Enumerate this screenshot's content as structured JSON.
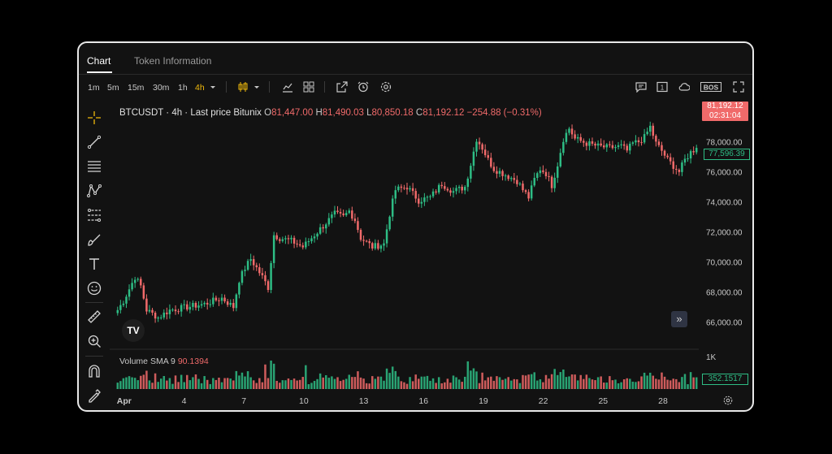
{
  "tabs": [
    {
      "label": "Chart",
      "active": true
    },
    {
      "label": "Token Information",
      "active": false
    }
  ],
  "toolbar": {
    "intervals": [
      "1m",
      "5m",
      "15m",
      "30m",
      "1h",
      "4h"
    ],
    "active_interval": "4h",
    "right_badge": "BOS",
    "one_label": "1"
  },
  "legend": {
    "symbol": "BTCUSDT · 4h · Last price Bitunix",
    "o_label": "O",
    "o": "81,447.00",
    "h_label": "H",
    "h": "81,490.03",
    "l_label": "L",
    "l": "80,850.18",
    "c_label": "C",
    "c": "81,192.12",
    "change": "−254.88 (−0.31%)"
  },
  "volume_legend": {
    "label": "Volume",
    "sma_label": "SMA 9",
    "sma_value": "90.1394"
  },
  "price_tag": {
    "price": "81,192.12",
    "countdown": "02:31:04"
  },
  "price_tag_secondary": "77,596.39",
  "volume_tag": "352.1517",
  "tv_logo": "TV",
  "scroll_icon": "»",
  "colors": {
    "up": "#2ebd85",
    "down": "#f06a6a",
    "accent": "#f0b90b",
    "background": "#121212"
  },
  "chart_data": {
    "type": "candlestick",
    "symbol": "BTCUSDT",
    "interval": "4h",
    "y_ticks": [
      "78,000.00",
      "76,000.00",
      "74,000.00",
      "72,000.00",
      "70,000.00",
      "68,000.00",
      "66,000.00"
    ],
    "y_tick_values": [
      78000,
      76000,
      74000,
      72000,
      70000,
      68000,
      66000
    ],
    "ylim": [
      65000,
      79600
    ],
    "volume_tick": "1K",
    "volume_ylim": [
      0,
      1000
    ],
    "x_ticks": [
      {
        "label": "Apr",
        "day": 1
      },
      {
        "label": "4",
        "day": 4
      },
      {
        "label": "7",
        "day": 7
      },
      {
        "label": "10",
        "day": 10
      },
      {
        "label": "13",
        "day": 13
      },
      {
        "label": "16",
        "day": 16
      },
      {
        "label": "19",
        "day": 19
      },
      {
        "label": "22",
        "day": 22
      },
      {
        "label": "25",
        "day": 25
      },
      {
        "label": "28",
        "day": 28
      }
    ],
    "x_start_day": 0.6,
    "x_end_day": 29.75,
    "candles_per_day": 6,
    "close_anchors": [
      [
        0,
        66800
      ],
      [
        2,
        67400
      ],
      [
        4,
        68200
      ],
      [
        6,
        69000
      ],
      [
        8,
        68400
      ],
      [
        10,
        66800
      ],
      [
        14,
        66300
      ],
      [
        18,
        66800
      ],
      [
        24,
        67000
      ],
      [
        30,
        67200
      ],
      [
        36,
        67600
      ],
      [
        40,
        67000
      ],
      [
        42,
        68800
      ],
      [
        44,
        69600
      ],
      [
        46,
        70200
      ],
      [
        50,
        69000
      ],
      [
        52,
        68300
      ],
      [
        54,
        71800
      ],
      [
        56,
        71600
      ],
      [
        60,
        71400
      ],
      [
        64,
        71000
      ],
      [
        68,
        71800
      ],
      [
        72,
        72600
      ],
      [
        75,
        73200
      ],
      [
        78,
        73000
      ],
      [
        80,
        73400
      ],
      [
        82,
        72800
      ],
      [
        84,
        71600
      ],
      [
        88,
        71000
      ],
      [
        92,
        71200
      ],
      [
        94,
        73200
      ],
      [
        96,
        74800
      ],
      [
        100,
        75000
      ],
      [
        104,
        74100
      ],
      [
        108,
        74300
      ],
      [
        112,
        75200
      ],
      [
        116,
        74700
      ],
      [
        120,
        75000
      ],
      [
        122,
        76500
      ],
      [
        124,
        78200
      ],
      [
        126,
        77600
      ],
      [
        128,
        76800
      ],
      [
        130,
        76200
      ],
      [
        134,
        75800
      ],
      [
        138,
        75400
      ],
      [
        140,
        74800
      ],
      [
        142,
        74300
      ],
      [
        144,
        75500
      ],
      [
        146,
        76200
      ],
      [
        148,
        75900
      ],
      [
        150,
        75100
      ],
      [
        152,
        76500
      ],
      [
        154,
        78200
      ],
      [
        156,
        78900
      ],
      [
        158,
        78200
      ],
      [
        162,
        77900
      ],
      [
        166,
        77700
      ],
      [
        170,
        77600
      ],
      [
        174,
        77700
      ],
      [
        176,
        77400
      ],
      [
        178,
        77900
      ],
      [
        180,
        78000
      ],
      [
        182,
        78300
      ],
      [
        184,
        79000
      ],
      [
        186,
        77900
      ],
      [
        188,
        77400
      ],
      [
        190,
        76800
      ],
      [
        192,
        76400
      ],
      [
        194,
        76000
      ],
      [
        196,
        76800
      ],
      [
        198,
        77300
      ],
      [
        200,
        77600
      ]
    ],
    "last_close": 77596.39,
    "volume_sma9": 90.1394,
    "last_volume": 352.1517
  }
}
